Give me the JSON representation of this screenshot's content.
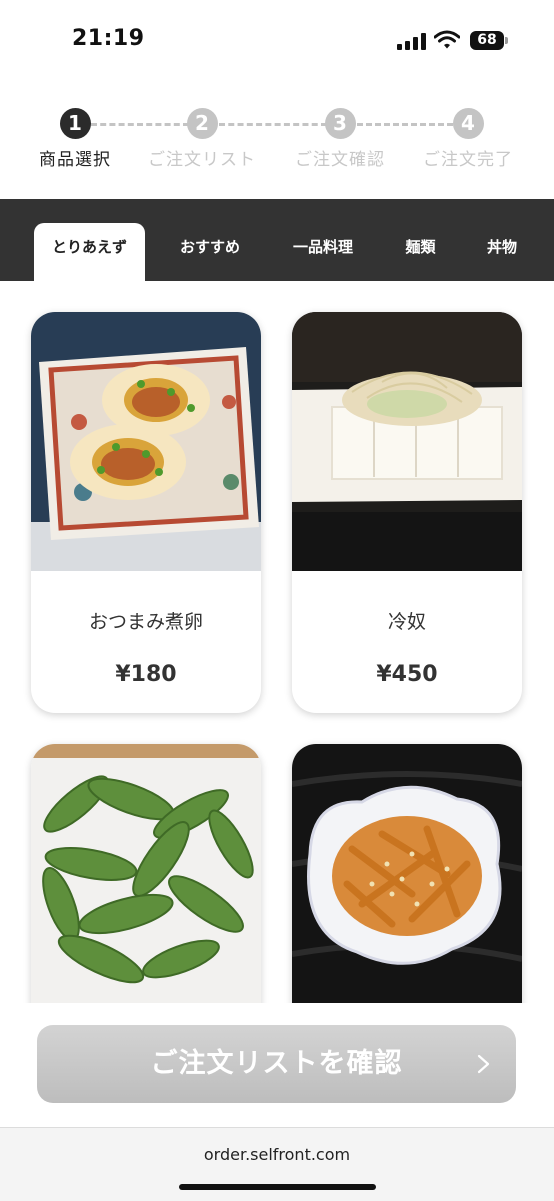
{
  "status_bar": {
    "time": "21:19",
    "battery": "68"
  },
  "stepper": {
    "steps": [
      {
        "number": "1",
        "label": "商品選択",
        "active": true
      },
      {
        "number": "2",
        "label": "ご注文リスト",
        "active": false
      },
      {
        "number": "3",
        "label": "ご注文確認",
        "active": false
      },
      {
        "number": "4",
        "label": "ご注文完了",
        "active": false
      }
    ]
  },
  "tabs": [
    {
      "label": "とりあえず",
      "active": true
    },
    {
      "label": "おすすめ"
    },
    {
      "label": "一品料理"
    },
    {
      "label": "麺類"
    },
    {
      "label": "丼物"
    }
  ],
  "products": [
    {
      "name": "おつまみ煮卵",
      "price": "¥180",
      "photo": "seasoned-egg-photo"
    },
    {
      "name": "冷奴",
      "price": "¥450",
      "photo": "cold-tofu-photo"
    },
    {
      "name": "",
      "price": "",
      "photo": "edamame-photo"
    },
    {
      "name": "",
      "price": "",
      "photo": "menma-photo"
    }
  ],
  "confirm_button": {
    "label": "ご注文リストを確認"
  },
  "browser": {
    "url": "order.selfront.com"
  },
  "colors": {
    "tab_bar": "#333333",
    "step_active": "#2b2b2b",
    "step_inactive": "#c4c4c4",
    "button": "#c8c8c8"
  }
}
